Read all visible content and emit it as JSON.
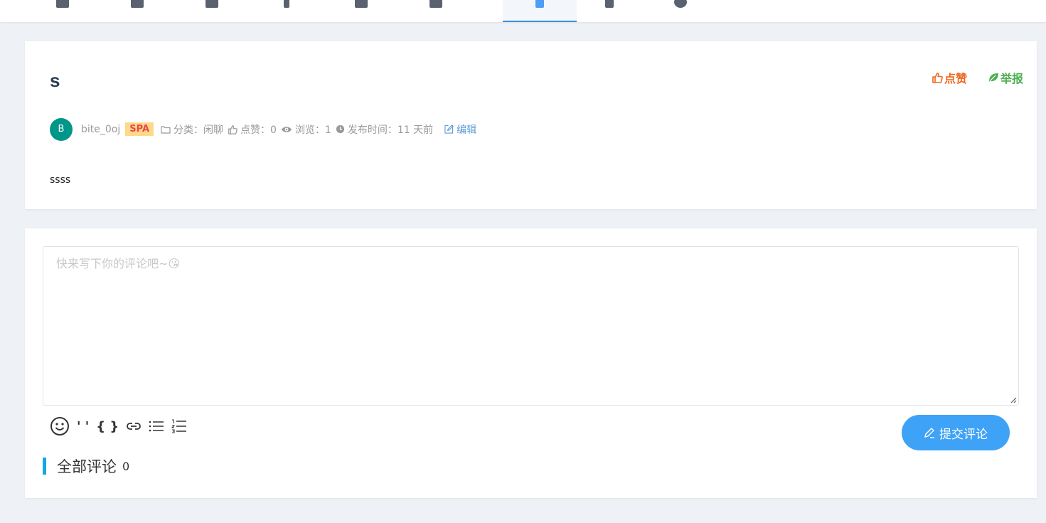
{
  "nav": {
    "items": [
      {
        "icon": "grid-icon"
      },
      {
        "icon": "grid-icon"
      },
      {
        "icon": "document-icon"
      },
      {
        "icon": "pen-icon"
      },
      {
        "icon": "list-icon"
      },
      {
        "icon": "chart-icon"
      },
      {
        "icon": "chat-icon",
        "active": true
      },
      {
        "icon": "bookmark-icon"
      },
      {
        "icon": "info-icon"
      }
    ]
  },
  "post": {
    "title": "s",
    "like_label": "点赞",
    "report_label": "举报",
    "author_initial": "B",
    "author": "bite_0oj",
    "badge": "SPA",
    "category": "分类：闲聊",
    "likes": "点赞：0",
    "views": "浏览：1",
    "published": "发布时间：11 天前",
    "edit_label": "编辑",
    "body": "ssss"
  },
  "comment": {
    "placeholder": "快来写下你的评论吧~😘",
    "quote_tool": "' '",
    "code_tool": "{ }",
    "submit_label": "提交评论",
    "section_title": "全部评论",
    "count": "0"
  },
  "colors": {
    "accent": "#3ea2f7",
    "like": "#f0661e",
    "report": "#4caf50",
    "avatar": "#009688",
    "badge_bg": "#ffd98a",
    "badge_text": "#e64a4a",
    "section_bar": "#14a7e8"
  }
}
